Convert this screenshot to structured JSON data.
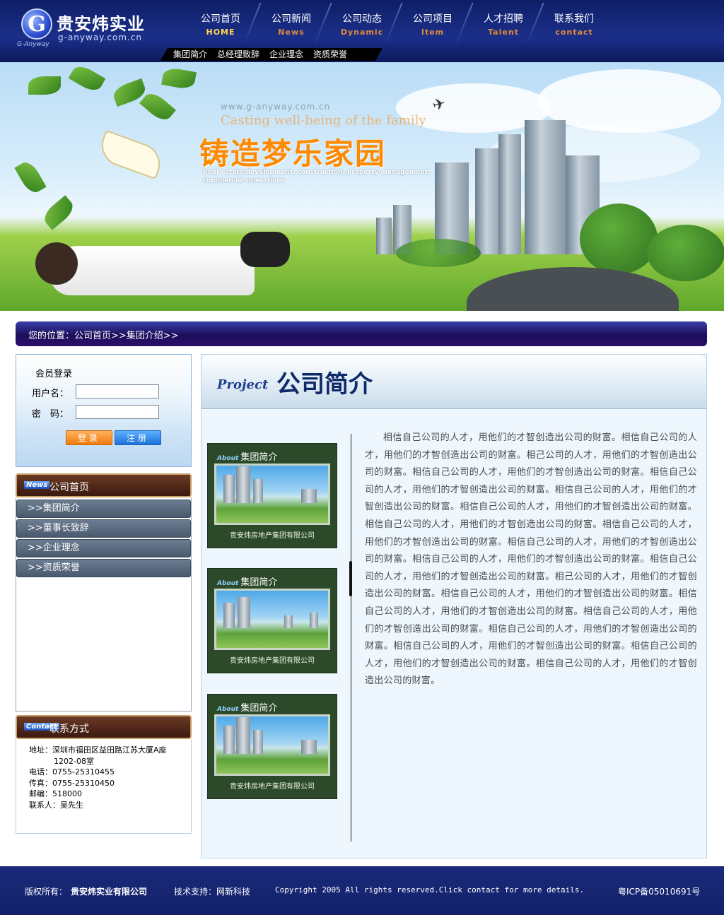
{
  "header": {
    "logo_title": "贵安炜实业",
    "logo_url": "g-anyway.com.cn",
    "logo_sub": "G-Anyway",
    "logo_letter": "G",
    "nav": [
      {
        "label": "公司首页",
        "en": "HOME"
      },
      {
        "label": "公司新闻",
        "en": "News"
      },
      {
        "label": "公司动态",
        "en": "Dynamic"
      },
      {
        "label": "公司项目",
        "en": "Item"
      },
      {
        "label": "人才招聘",
        "en": "Talent"
      },
      {
        "label": "联系我们",
        "en": "contact"
      }
    ],
    "subnav": [
      "集团简介",
      "总经理致辞",
      "企业理念",
      "资质荣誉"
    ]
  },
  "banner": {
    "url": "www.g-anyway.com.cn",
    "en_title": "Casting well-being of the family",
    "cn_title": "铸造梦乐家园",
    "desc": "Real estate development, construction, property management, commercial operations"
  },
  "breadcrumb": {
    "text": "您的位置：公司首页>>集团介绍>>"
  },
  "login": {
    "title": "会员登录",
    "username_label": "用户名：",
    "password_label": "密　码：",
    "username_value": "",
    "password_value": "",
    "login_button": "登录",
    "register_button": "注册"
  },
  "news_box": {
    "tag": "News",
    "title": "公司首页",
    "items": [
      ">>集团简介",
      ">>董事长致辞",
      ">>企业理念",
      ">>资质荣誉"
    ]
  },
  "contact_box": {
    "tag": "Contact",
    "title": "联系方式",
    "address": "地址：深圳市福田区益田路江苏大厦A座",
    "address2": "1202-08室",
    "phone": "电话：0755-25310455",
    "fax": "传真：0755-25310450",
    "zip": "邮编：518000",
    "person": "联系人：吴先生"
  },
  "main": {
    "title_en": "Project",
    "title_cn": "公司简介",
    "cards": [
      {
        "tag": "About",
        "caption": "集团简介",
        "name": "贵安炜房地产集团有限公司"
      },
      {
        "tag": "About",
        "caption": "集团简介",
        "name": "贵安炜房地产集团有限公司"
      },
      {
        "tag": "About",
        "caption": "集团简介",
        "name": "贵安炜房地产集团有限公司"
      }
    ],
    "body": "相信自己公司的人才，用他们的才智创造出公司的财富。相信自己公司的人才，用他们的才智创造出公司的财富。相己公司的人才，用他们的才智创造出公司的财富。相信自己公司的人才，用他们的才智创造出公司的财富。相信自己公司的人才，用他们的才智创造出公司的财富。相信自己公司的人才，用他们的才智创造出公司的财富。相信自己公司的人才，用他们的才智创造出公司的财富。相信自己公司的人才，用他们的才智创造出公司的财富。相信自己公司的人才，用他们的才智创造出公司的财富。相信自己公司的人才，用他们的才智创造出公司的财富。相信自己公司的人才，用他们的才智创造出公司的财富。相信自己公司的人才，用他们的才智创造出公司的财富。相己公司的人才，用他们的才智创造出公司的财富。相信自己公司的人才，用他们的才智创造出公司的财富。相信自己公司的人才，用他们的才智创造出公司的财富。相信自己公司的人才，用他们的才智创造出公司的财富。相信自己公司的人才，用他们的才智创造出公司的财富。相信自己公司的人才，用他们的才智创造出公司的财富。相信自己公司的人才，用他们的才智创造出公司的财富。相信自己公司的人才，用他们的才智创造出公司的财富。"
  },
  "footer": {
    "copyright_label": "版权所有：",
    "company": "贵安炜实业有限公司",
    "support": "技术支持：网新科技",
    "copyright_en": "Copyright 2005 All rights reserved.Click contact for more details.",
    "icp": "粤ICP备05010691号"
  },
  "colors": {
    "header_bg": "#1b2f8a",
    "accent_orange": "#ff8a00",
    "crumb_bg": "#1c0f5c",
    "footer_bg": "#14216a",
    "card_bg": "#2c4a2a"
  }
}
